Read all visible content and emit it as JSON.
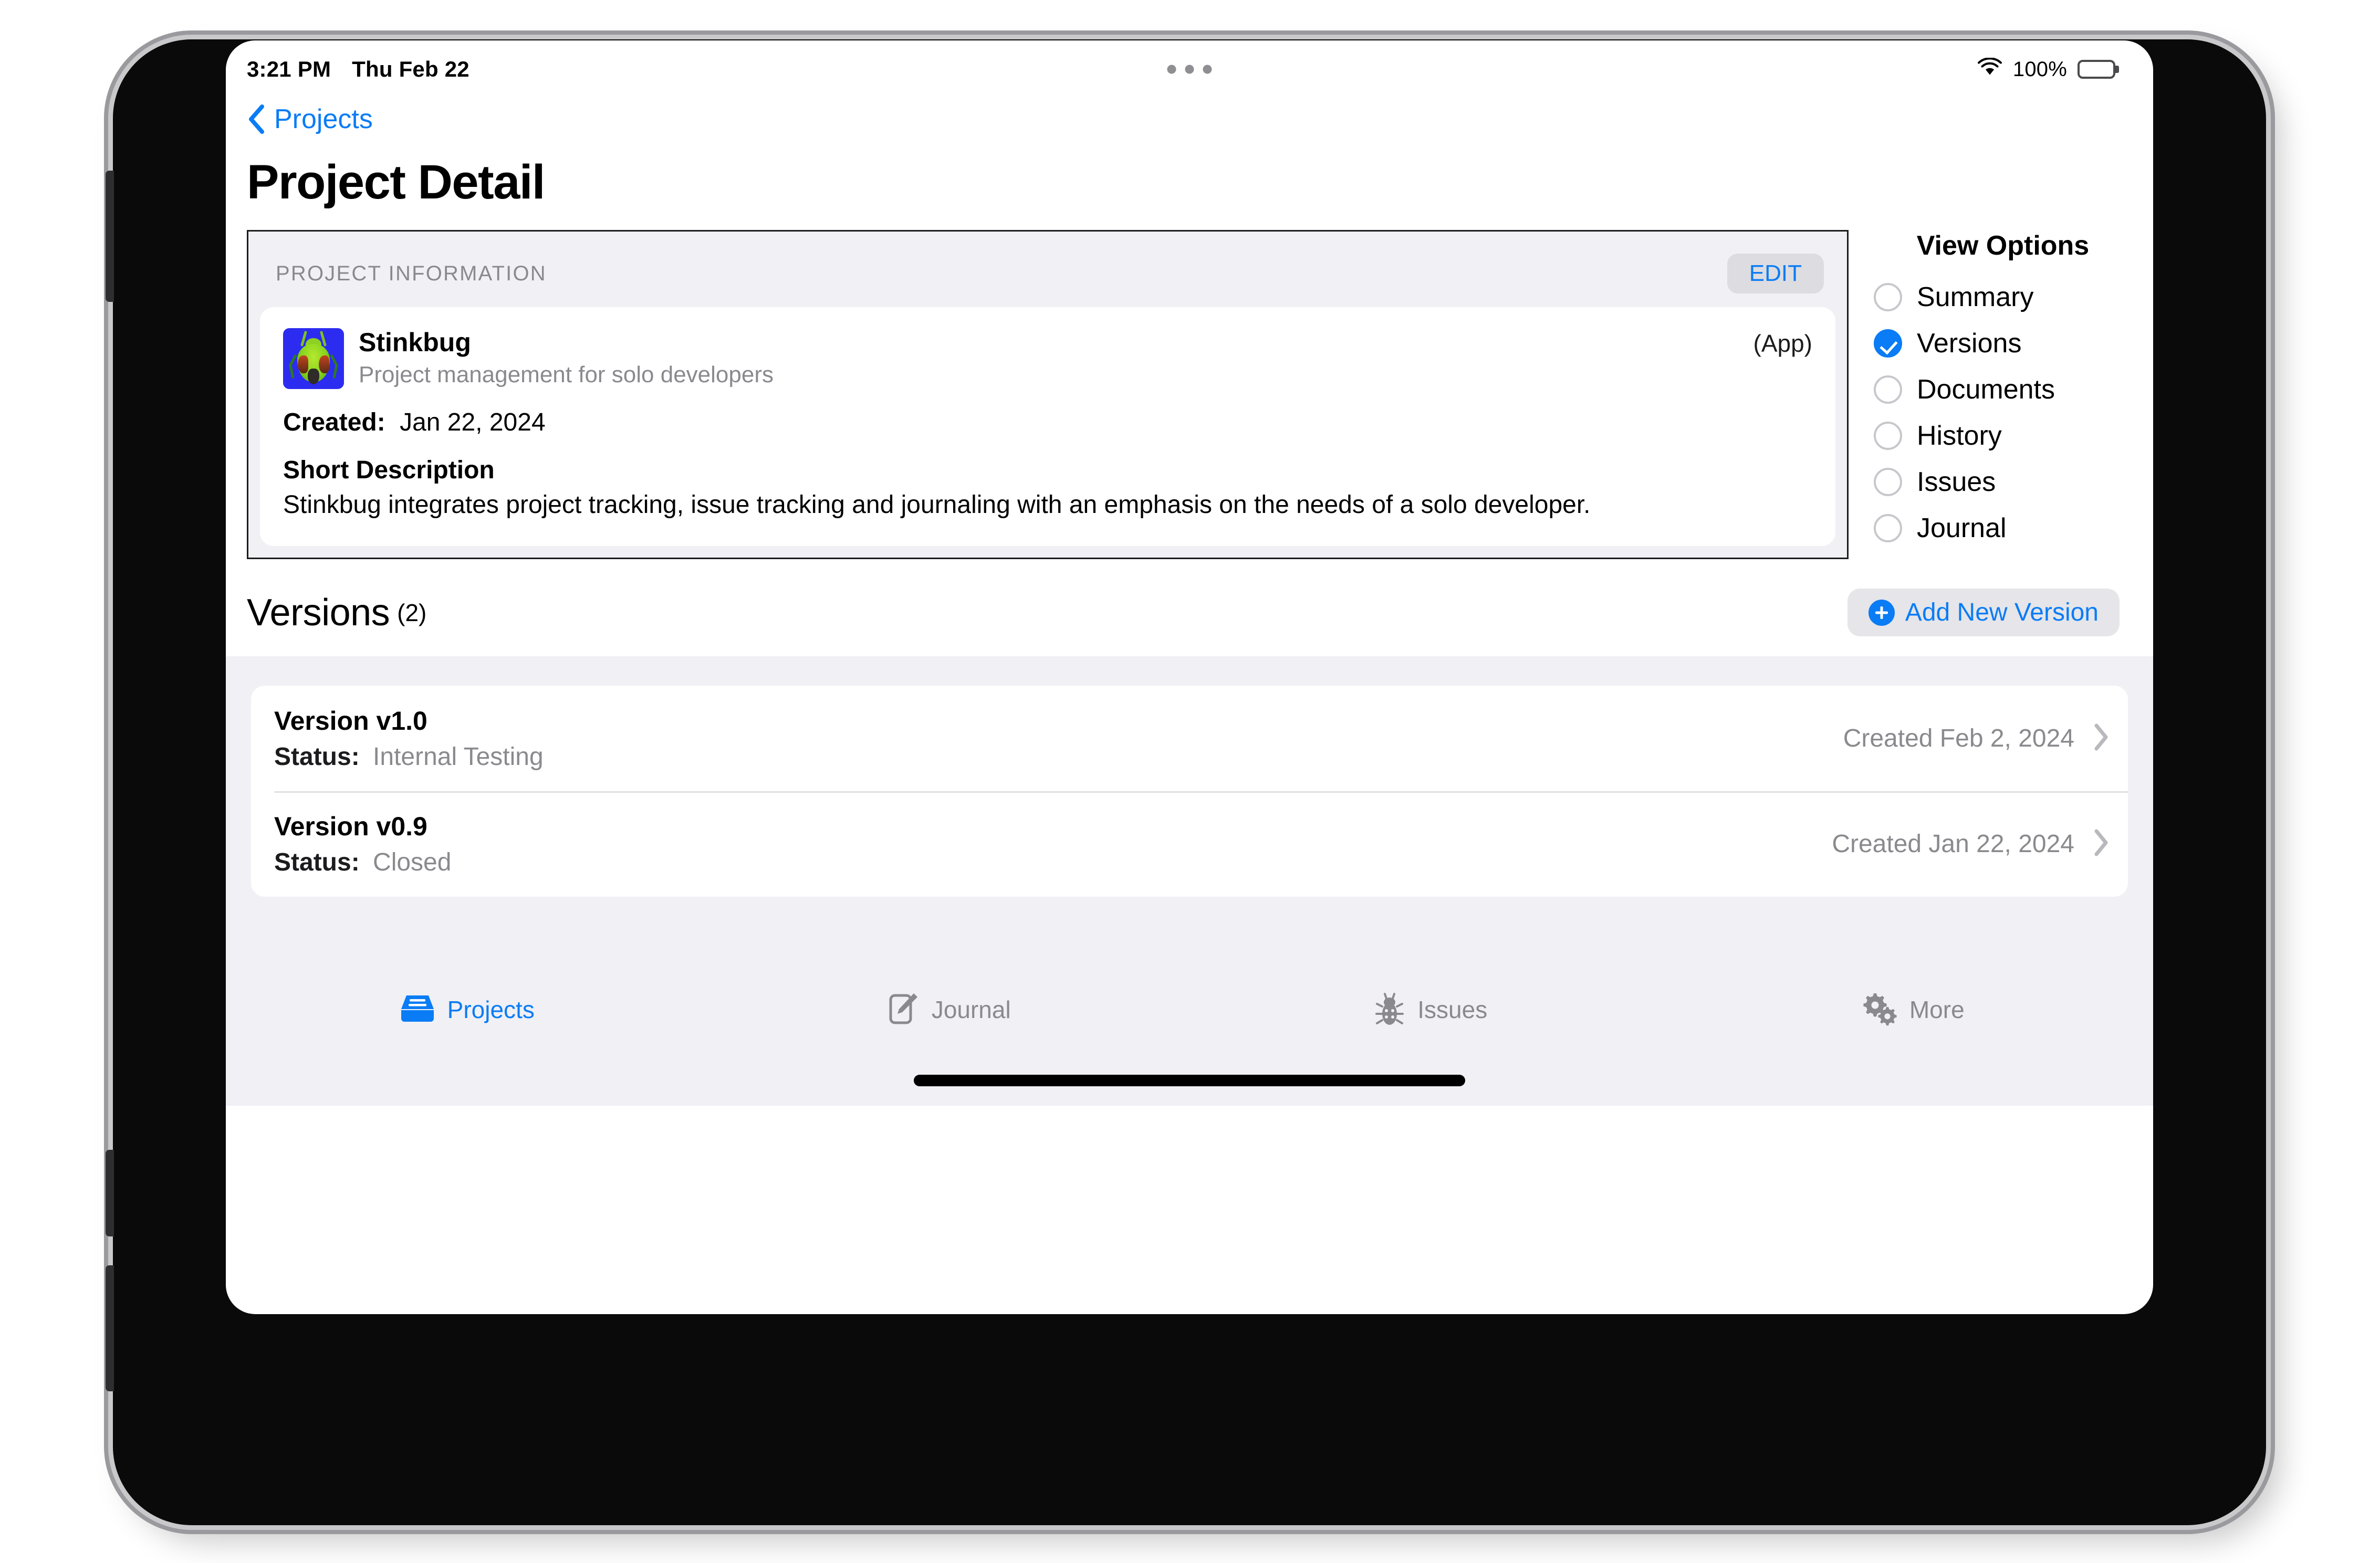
{
  "status_bar": {
    "time": "3:21 PM",
    "date": "Thu Feb 22",
    "battery_percent": "100%",
    "wifi_icon": "wifi-icon",
    "battery_icon": "battery-full-icon",
    "multitask_icon": "multitasking-dots-icon"
  },
  "nav": {
    "back_label": "Projects",
    "back_icon": "chevron-left-icon"
  },
  "header": {
    "page_title": "Project Detail"
  },
  "project_information": {
    "section_label": "PROJECT INFORMATION",
    "edit_label": "EDIT",
    "app_icon": "stinkbug-app-icon",
    "name": "Stinkbug",
    "subtitle": "Project management for solo developers",
    "kind": "(App)",
    "created_label": "Created:",
    "created_value": "Jan 22, 2024",
    "short_description_label": "Short Description",
    "short_description_text": "Stinkbug integrates project tracking, issue tracking and journaling with an emphasis on the needs of a solo developer."
  },
  "view_options": {
    "title": "View Options",
    "selected": "Versions",
    "items": [
      {
        "label": "Summary",
        "selected": false
      },
      {
        "label": "Versions",
        "selected": true
      },
      {
        "label": "Documents",
        "selected": false
      },
      {
        "label": "History",
        "selected": false
      },
      {
        "label": "Issues",
        "selected": false
      },
      {
        "label": "Journal",
        "selected": false
      }
    ]
  },
  "versions_section": {
    "title": "Versions",
    "count_label": "(2)",
    "add_button_label": "Add New Version",
    "add_button_icon": "plus-circle-icon",
    "status_label": "Status:",
    "chevron_icon": "chevron-right-icon",
    "rows": [
      {
        "name": "Version v1.0",
        "status_label": "Status:",
        "status_value": "Internal Testing",
        "created": "Created Feb 2, 2024"
      },
      {
        "name": "Version v0.9",
        "status_label": "Status:",
        "status_value": "Closed",
        "created": "Created Jan 22, 2024"
      }
    ]
  },
  "tab_bar": {
    "items": [
      {
        "label": "Projects",
        "icon": "projects-tray-icon",
        "active": true
      },
      {
        "label": "Journal",
        "icon": "journal-pencil-icon",
        "active": false
      },
      {
        "label": "Issues",
        "icon": "bug-icon",
        "active": false
      },
      {
        "label": "More",
        "icon": "gears-icon",
        "active": false
      }
    ]
  },
  "colors": {
    "accent_blue": "#0a7cf5",
    "secondary_text": "#8a8a8e",
    "panel_grey": "#f0f0f5",
    "button_grey": "#e5e5ea"
  }
}
